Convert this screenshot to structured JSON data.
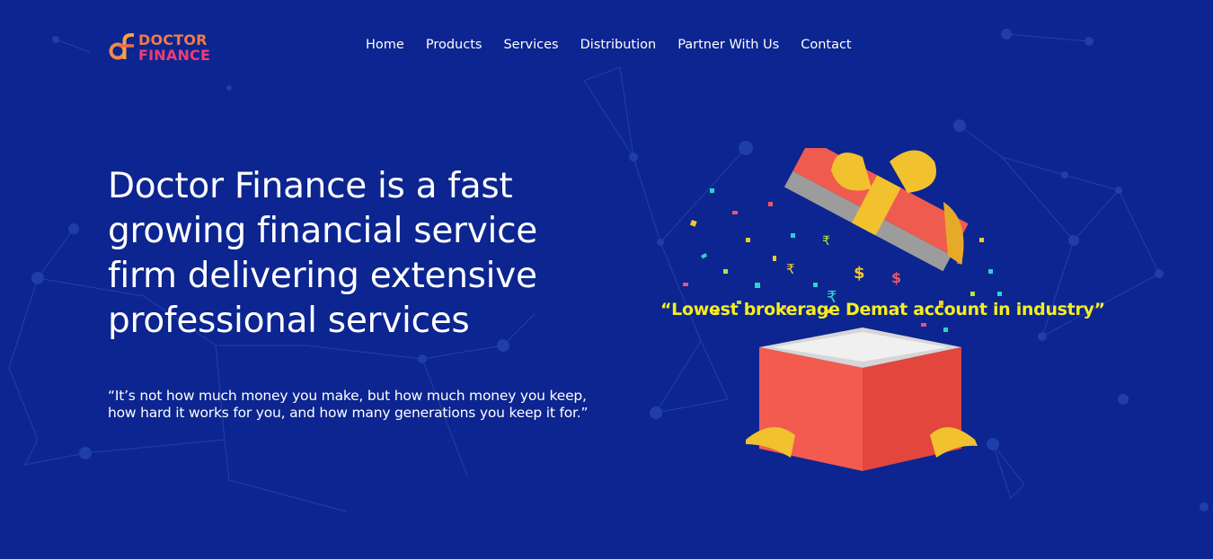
{
  "brand": {
    "name_line1": "DOCTOR",
    "name_line2": "FINANCE",
    "colors": {
      "background": "#0c2590",
      "brand_orange": "#f07a4c",
      "brand_pink": "#ef3c74",
      "tagline_yellow": "#f5ee1e"
    }
  },
  "nav": {
    "items": [
      "Home",
      "Products",
      "Services",
      "Distribution",
      "Partner With Us",
      "Contact"
    ]
  },
  "hero": {
    "headline": "Doctor Finance is a fast growing financial service firm delivering extensive professional services",
    "quote": "“It’s not how much money you make, but how much money you keep, how hard it works for you, and how many generations you keep it for.”"
  },
  "promo": {
    "tagline": "“Lowest brokerage Demat account in industry”",
    "image_icon": "open-gift-box-icon"
  }
}
